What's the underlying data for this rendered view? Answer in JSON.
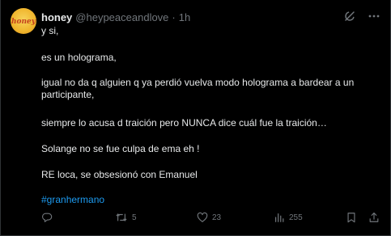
{
  "post": {
    "author_name": "honey",
    "author_handle": "@heypeaceandlove",
    "separator": "·",
    "time": "1h",
    "avatar_text": "honey",
    "lines": [
      "y si,",
      "es un holograma,",
      "igual no da q  alguien q ya perdió  vuelva modo holograma a  bardear a un participante,",
      "siempre lo acusa d traición pero NUNCA dice cuál fue la traición…",
      "Solange no se fue culpa de ema eh !",
      "RE loca, se obsesionó con Emanuel"
    ],
    "hashtag": "#granhermano"
  },
  "actions": {
    "replies": "",
    "reposts": "5",
    "likes": "23",
    "views": "255"
  },
  "colors": {
    "background": "#000000",
    "text": "#e7e9ea",
    "secondary": "#71767b",
    "link": "#1d9bf0",
    "avatar": "#f0b52d"
  },
  "icons": {
    "header": [
      "grok-icon",
      "more-options-icon"
    ],
    "actions": [
      "reply-icon",
      "repost-icon",
      "like-icon",
      "views-icon",
      "bookmark-icon",
      "share-icon"
    ]
  }
}
